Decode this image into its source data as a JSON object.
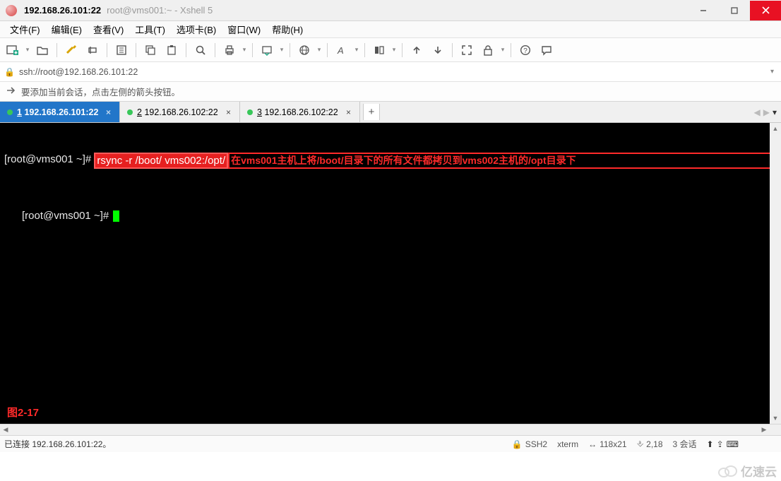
{
  "titlebar": {
    "host": "192.168.26.101:22",
    "rest": "root@vms001:~ - Xshell 5"
  },
  "menu": {
    "file": "文件(F)",
    "edit": "编辑(E)",
    "view": "查看(V)",
    "tools": "工具(T)",
    "tab": "选项卡(B)",
    "window": "窗口(W)",
    "help": "帮助(H)"
  },
  "addressbar": {
    "text": "ssh://root@192.168.26.101:22"
  },
  "infobar": {
    "text": "要添加当前会话，点击左侧的箭头按钮。"
  },
  "tabs": [
    {
      "num": "1",
      "label": "192.168.26.101:22",
      "active": true
    },
    {
      "num": "2",
      "label": "192.168.26.102:22",
      "active": false
    },
    {
      "num": "3",
      "label": "192.168.26.102:22",
      "active": false
    }
  ],
  "terminal": {
    "prompt1": "[root@vms001 ~]# ",
    "command": "rsync -r /boot/ vms002:/opt/",
    "annotation": "在vms001主机上将/boot/目录下的所有文件都拷贝到vms002主机的/opt目录下",
    "prompt2": "[root@vms001 ~]# ",
    "figure_label": "图2-17"
  },
  "status": {
    "left": "已连接 192.168.26.101:22。",
    "protocol": "SSH2",
    "termtype": "xterm",
    "size": "118x21",
    "pos": "2,18",
    "sessions": "3 会话"
  },
  "watermark": {
    "text": "亿速云"
  }
}
